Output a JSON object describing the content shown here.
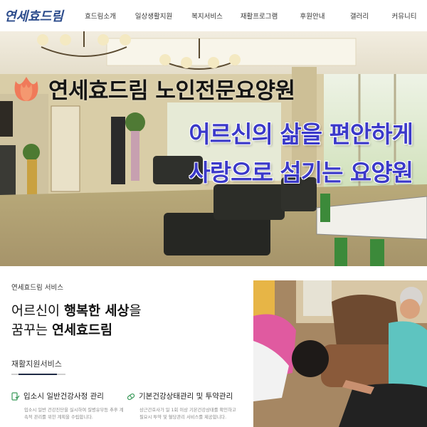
{
  "brand": {
    "logo_text": "연세효드림"
  },
  "nav": [
    {
      "label": "효드림소개"
    },
    {
      "label": "일상생활지원"
    },
    {
      "label": "복지서비스"
    },
    {
      "label": "재활프로그램"
    },
    {
      "label": "후원안내"
    },
    {
      "label": "갤러리"
    },
    {
      "label": "커뮤니티"
    }
  ],
  "hero": {
    "title": "연세효드림 노인전문요양원",
    "subtitle_line1": "어르신의 삶을 편안하게",
    "subtitle_line2": "사랑으로 섬기는 요양원",
    "logo_icon": "tulip-icon",
    "colors": {
      "subtitle": "#3b39c9",
      "tulip": "#f07a5a"
    }
  },
  "services": {
    "label": "연세효드림 서비스",
    "heading_normal_1": "어르신이 ",
    "heading_bold_1": "행복한 세상",
    "heading_normal_2": "을",
    "heading_normal_3": "꿈꾸는 ",
    "heading_bold_2": "연세효드림",
    "subsection_title": "재활지원서비스",
    "items": [
      {
        "icon": "checkup-icon",
        "title": "입소시 일반건강사정 관리",
        "desc": "입소시 일반 건강진단을 실시하여 질병유무등 추후 계속적 관리를 위한 계획을 수립합니다."
      },
      {
        "icon": "medicine-icon",
        "title": "기본건강상태관리 및 투약관리",
        "desc": "상근간호사가 일 1회 이상 기본건강상태를 확인하고 필요시 투약 및 혈당관리 서비스를 제공합니다."
      }
    ]
  },
  "colors": {
    "accent_dark": "#1f2a44",
    "logo_blue": "#2c4c8c",
    "icon_green": "#3a9a5a"
  }
}
